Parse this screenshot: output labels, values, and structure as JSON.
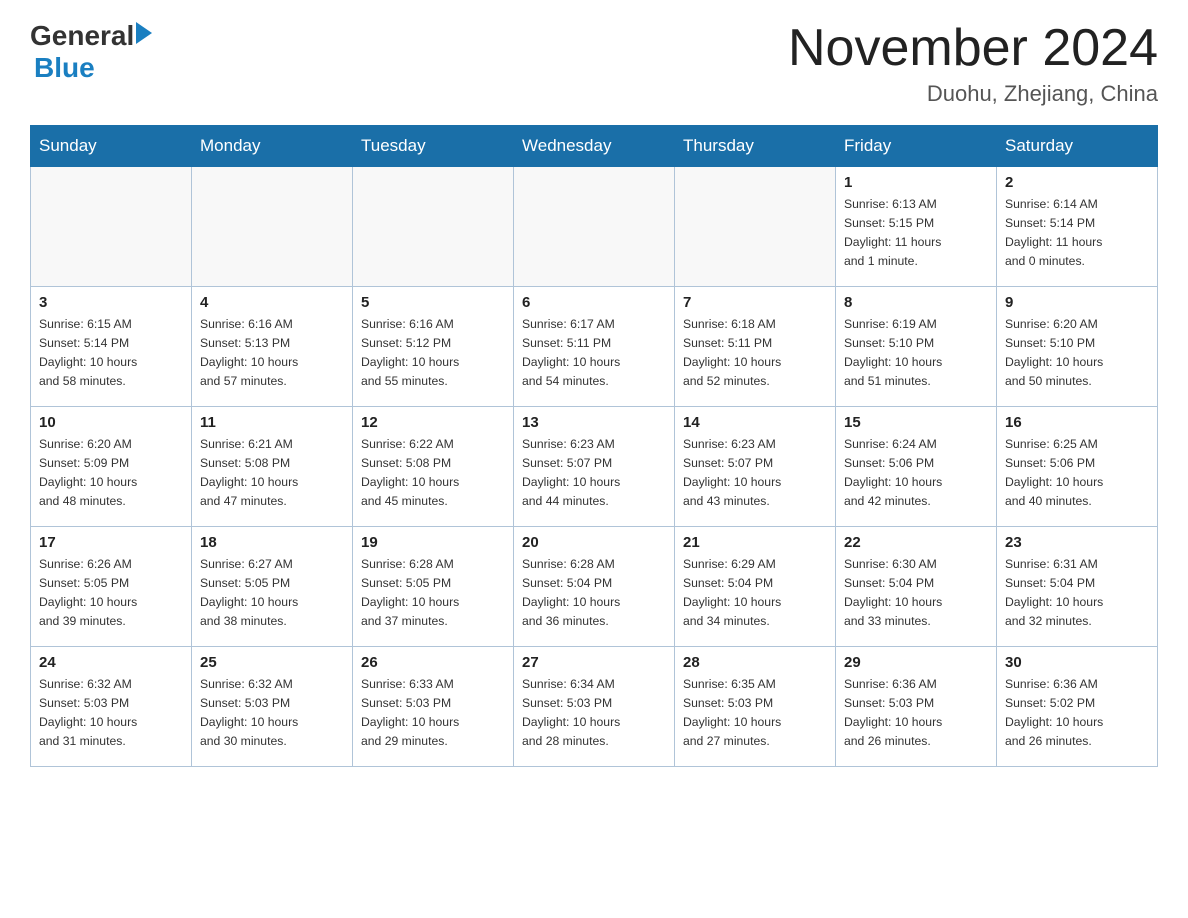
{
  "header": {
    "logo_general": "General",
    "logo_blue": "Blue",
    "title": "November 2024",
    "subtitle": "Duohu, Zhejiang, China"
  },
  "days_of_week": [
    "Sunday",
    "Monday",
    "Tuesday",
    "Wednesday",
    "Thursday",
    "Friday",
    "Saturday"
  ],
  "weeks": [
    [
      {
        "day": "",
        "info": ""
      },
      {
        "day": "",
        "info": ""
      },
      {
        "day": "",
        "info": ""
      },
      {
        "day": "",
        "info": ""
      },
      {
        "day": "",
        "info": ""
      },
      {
        "day": "1",
        "info": "Sunrise: 6:13 AM\nSunset: 5:15 PM\nDaylight: 11 hours\nand 1 minute."
      },
      {
        "day": "2",
        "info": "Sunrise: 6:14 AM\nSunset: 5:14 PM\nDaylight: 11 hours\nand 0 minutes."
      }
    ],
    [
      {
        "day": "3",
        "info": "Sunrise: 6:15 AM\nSunset: 5:14 PM\nDaylight: 10 hours\nand 58 minutes."
      },
      {
        "day": "4",
        "info": "Sunrise: 6:16 AM\nSunset: 5:13 PM\nDaylight: 10 hours\nand 57 minutes."
      },
      {
        "day": "5",
        "info": "Sunrise: 6:16 AM\nSunset: 5:12 PM\nDaylight: 10 hours\nand 55 minutes."
      },
      {
        "day": "6",
        "info": "Sunrise: 6:17 AM\nSunset: 5:11 PM\nDaylight: 10 hours\nand 54 minutes."
      },
      {
        "day": "7",
        "info": "Sunrise: 6:18 AM\nSunset: 5:11 PM\nDaylight: 10 hours\nand 52 minutes."
      },
      {
        "day": "8",
        "info": "Sunrise: 6:19 AM\nSunset: 5:10 PM\nDaylight: 10 hours\nand 51 minutes."
      },
      {
        "day": "9",
        "info": "Sunrise: 6:20 AM\nSunset: 5:10 PM\nDaylight: 10 hours\nand 50 minutes."
      }
    ],
    [
      {
        "day": "10",
        "info": "Sunrise: 6:20 AM\nSunset: 5:09 PM\nDaylight: 10 hours\nand 48 minutes."
      },
      {
        "day": "11",
        "info": "Sunrise: 6:21 AM\nSunset: 5:08 PM\nDaylight: 10 hours\nand 47 minutes."
      },
      {
        "day": "12",
        "info": "Sunrise: 6:22 AM\nSunset: 5:08 PM\nDaylight: 10 hours\nand 45 minutes."
      },
      {
        "day": "13",
        "info": "Sunrise: 6:23 AM\nSunset: 5:07 PM\nDaylight: 10 hours\nand 44 minutes."
      },
      {
        "day": "14",
        "info": "Sunrise: 6:23 AM\nSunset: 5:07 PM\nDaylight: 10 hours\nand 43 minutes."
      },
      {
        "day": "15",
        "info": "Sunrise: 6:24 AM\nSunset: 5:06 PM\nDaylight: 10 hours\nand 42 minutes."
      },
      {
        "day": "16",
        "info": "Sunrise: 6:25 AM\nSunset: 5:06 PM\nDaylight: 10 hours\nand 40 minutes."
      }
    ],
    [
      {
        "day": "17",
        "info": "Sunrise: 6:26 AM\nSunset: 5:05 PM\nDaylight: 10 hours\nand 39 minutes."
      },
      {
        "day": "18",
        "info": "Sunrise: 6:27 AM\nSunset: 5:05 PM\nDaylight: 10 hours\nand 38 minutes."
      },
      {
        "day": "19",
        "info": "Sunrise: 6:28 AM\nSunset: 5:05 PM\nDaylight: 10 hours\nand 37 minutes."
      },
      {
        "day": "20",
        "info": "Sunrise: 6:28 AM\nSunset: 5:04 PM\nDaylight: 10 hours\nand 36 minutes."
      },
      {
        "day": "21",
        "info": "Sunrise: 6:29 AM\nSunset: 5:04 PM\nDaylight: 10 hours\nand 34 minutes."
      },
      {
        "day": "22",
        "info": "Sunrise: 6:30 AM\nSunset: 5:04 PM\nDaylight: 10 hours\nand 33 minutes."
      },
      {
        "day": "23",
        "info": "Sunrise: 6:31 AM\nSunset: 5:04 PM\nDaylight: 10 hours\nand 32 minutes."
      }
    ],
    [
      {
        "day": "24",
        "info": "Sunrise: 6:32 AM\nSunset: 5:03 PM\nDaylight: 10 hours\nand 31 minutes."
      },
      {
        "day": "25",
        "info": "Sunrise: 6:32 AM\nSunset: 5:03 PM\nDaylight: 10 hours\nand 30 minutes."
      },
      {
        "day": "26",
        "info": "Sunrise: 6:33 AM\nSunset: 5:03 PM\nDaylight: 10 hours\nand 29 minutes."
      },
      {
        "day": "27",
        "info": "Sunrise: 6:34 AM\nSunset: 5:03 PM\nDaylight: 10 hours\nand 28 minutes."
      },
      {
        "day": "28",
        "info": "Sunrise: 6:35 AM\nSunset: 5:03 PM\nDaylight: 10 hours\nand 27 minutes."
      },
      {
        "day": "29",
        "info": "Sunrise: 6:36 AM\nSunset: 5:03 PM\nDaylight: 10 hours\nand 26 minutes."
      },
      {
        "day": "30",
        "info": "Sunrise: 6:36 AM\nSunset: 5:02 PM\nDaylight: 10 hours\nand 26 minutes."
      }
    ]
  ]
}
